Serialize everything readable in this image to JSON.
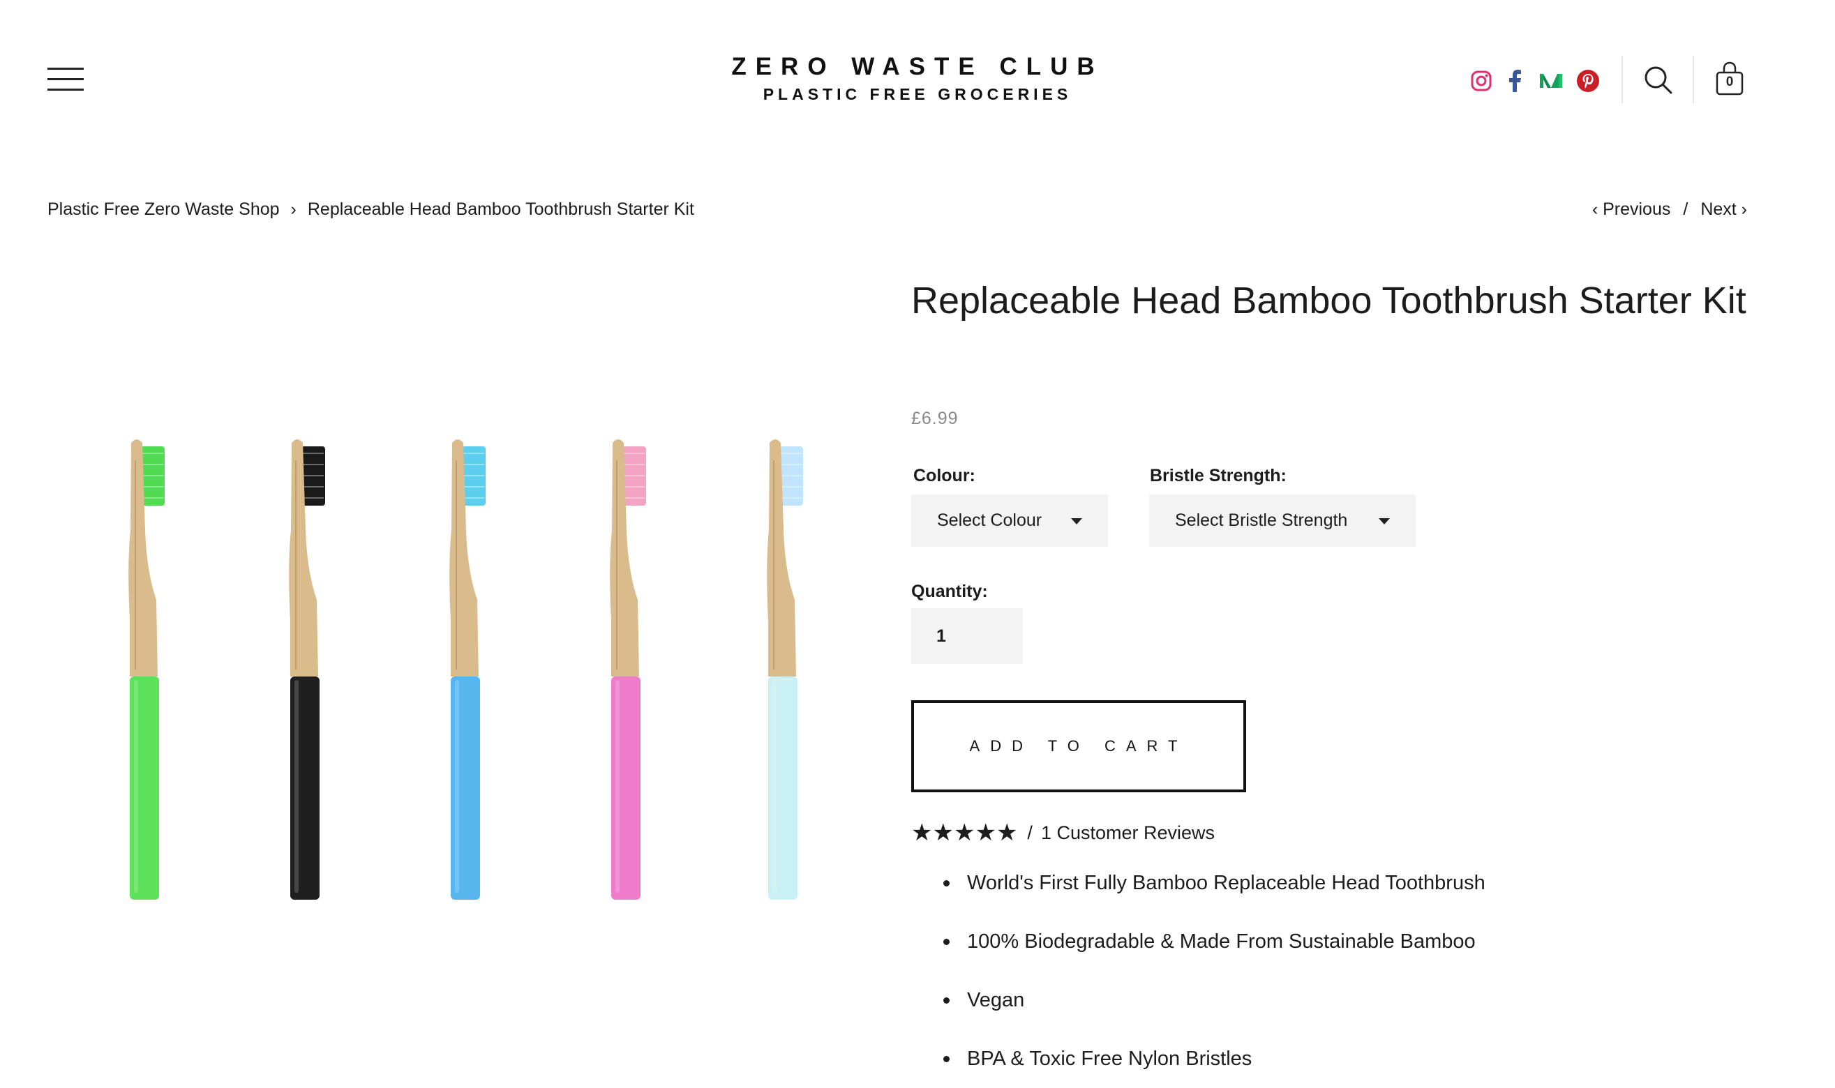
{
  "header": {
    "logo_title": "ZERO WASTE CLUB",
    "logo_subtitle": "PLASTIC FREE GROCERIES",
    "social_icons": [
      "instagram-icon",
      "facebook-icon",
      "medium-icon",
      "pinterest-icon"
    ],
    "cart_count": "0"
  },
  "breadcrumb": {
    "home": "Plastic Free Zero Waste Shop",
    "separator": "›",
    "current": "Replaceable Head Bamboo Toothbrush Starter Kit"
  },
  "pager": {
    "previous": "‹ Previous",
    "slash": "/",
    "next": "Next ›"
  },
  "product": {
    "title": "Replaceable Head Bamboo Toothbrush Starter Kit",
    "price": "£6.99",
    "colour_label": "Colour:",
    "colour_value": "Select Colour",
    "bristle_label": "Bristle Strength:",
    "bristle_value": "Select Bristle Strength",
    "quantity_label": "Quantity:",
    "quantity_value": "1",
    "add_to_cart": "ADD TO CART",
    "rating": 5,
    "rating_max": 5,
    "rating_separator": "/",
    "reviews_text": "1 Customer Reviews",
    "features": [
      "World's First Fully Bamboo Replaceable Head Toothbrush",
      "100% Biodegradable & Made From Sustainable Bamboo",
      "Vegan",
      "BPA & Toxic Free Nylon Bristles"
    ]
  },
  "colors": {
    "instagram": "#e1306c",
    "facebook": "#3b5998",
    "medium": "#12a25c",
    "pinterest": "#cb2027",
    "bamboo": "#d9bb8c",
    "brush_colors": [
      "#5de05a",
      "#1f1f1f",
      "#57b6ee",
      "#ee7ccb",
      "#c8f0f5"
    ],
    "bristle_colors": [
      "#4fdc52",
      "#1a1a1a",
      "#5ccfee",
      "#f3a3c3",
      "#bfe4fb"
    ]
  }
}
